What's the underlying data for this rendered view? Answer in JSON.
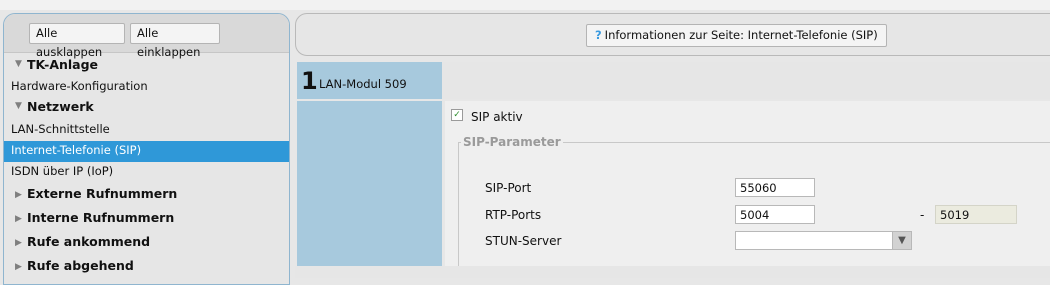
{
  "sidebar": {
    "expand_all": "Alle ausklappen",
    "collapse_all": "Alle einklappen",
    "groups": [
      {
        "label": "TK-Anlage",
        "items": [
          "Hardware-Konfiguration"
        ]
      },
      {
        "label": "Netzwerk",
        "items": [
          "LAN-Schnittstelle",
          "Internet-Telefonie (SIP)",
          "ISDN über IP (IoP)"
        ]
      },
      {
        "label": "Externe Rufnummern"
      },
      {
        "label": "Interne Rufnummern"
      },
      {
        "label": "Rufe ankommend"
      },
      {
        "label": "Rufe abgehend"
      }
    ],
    "selected": "Internet-Telefonie (SIP)"
  },
  "header": {
    "info_button": "Informationen zur Seite: Internet-Telefonie (SIP)",
    "info_icon": "help-icon"
  },
  "tab": {
    "number": "1",
    "label": "LAN-Modul 509"
  },
  "form": {
    "sip_active_label": "SIP aktiv",
    "sip_active_checked": true,
    "fieldset_legend": "SIP-Parameter",
    "sip_port_label": "SIP-Port",
    "sip_port_value": "55060",
    "rtp_ports_label": "RTP-Ports",
    "rtp_from_value": "5004",
    "rtp_separator": "-",
    "rtp_to_value": "5019",
    "stun_label": "STUN-Server",
    "stun_value": ""
  },
  "colors": {
    "selected_bg": "#2f98d8",
    "panel_blue": "#a7c9dd",
    "help_icon": "#3b9be0"
  }
}
